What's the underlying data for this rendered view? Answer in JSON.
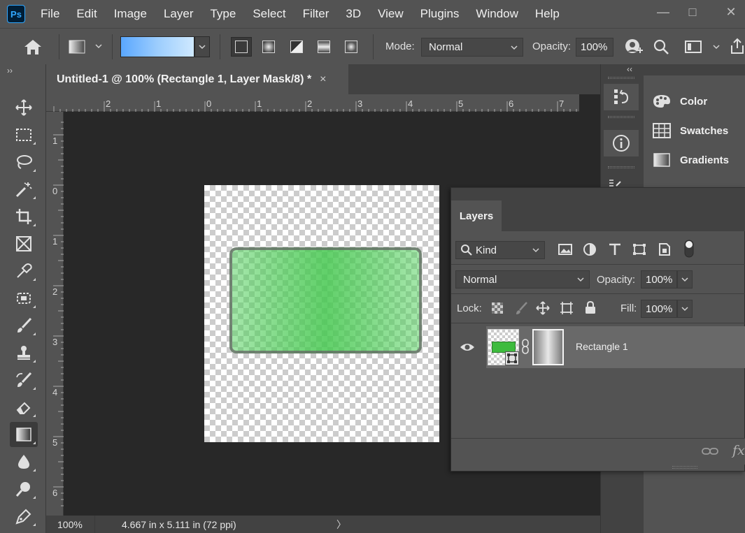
{
  "app": {
    "logo": "Ps"
  },
  "menu": [
    "File",
    "Edit",
    "Image",
    "Layer",
    "Type",
    "Select",
    "Filter",
    "3D",
    "View",
    "Plugins",
    "Window",
    "Help"
  ],
  "window_controls": {
    "minimize": "—",
    "maximize": "□",
    "close": "✕"
  },
  "options_bar": {
    "mode_label": "Mode:",
    "mode_value": "Normal",
    "opacity_label": "Opacity:",
    "opacity_value": "100%"
  },
  "document": {
    "tab_title": "Untitled-1 @ 100% (Rectangle 1, Layer Mask/8) *",
    "tab_close": "×"
  },
  "rulers": {
    "horizontal": [
      "2",
      "1",
      "0",
      "1",
      "2",
      "3",
      "4",
      "5",
      "6",
      "7"
    ],
    "vertical": [
      "1",
      "0",
      "1",
      "2",
      "3",
      "4",
      "5",
      "6"
    ]
  },
  "status": {
    "zoom": "100%",
    "doc_info": "4.667 in x 5.111 in (72 ppi)",
    "arrow": "〉"
  },
  "panels_collapse": {
    "left": "››",
    "right": "‹‹"
  },
  "right_panels": [
    {
      "icon": "palette-icon",
      "label": "Color"
    },
    {
      "icon": "grid-icon",
      "label": "Swatches"
    },
    {
      "icon": "gradient-icon",
      "label": "Gradients"
    }
  ],
  "layers_panel": {
    "tab": "Layers",
    "filter_kind": "Kind",
    "blend_mode": "Normal",
    "opacity_label": "Opacity:",
    "opacity_value": "100%",
    "lock_label": "Lock:",
    "fill_label": "Fill:",
    "fill_value": "100%",
    "layers": [
      {
        "name": "Rectangle 1",
        "visible": true,
        "thumb_color": "#3dbb3d"
      }
    ],
    "footer": {
      "fx": "fx"
    }
  },
  "colors": {
    "ui_dark": "#282828",
    "ui_mid": "#424242",
    "ui_panel": "#535353",
    "accent_green": "#4fc85a",
    "gradient_start": "#5aa7ff",
    "gradient_end": "#cfe9ff"
  }
}
